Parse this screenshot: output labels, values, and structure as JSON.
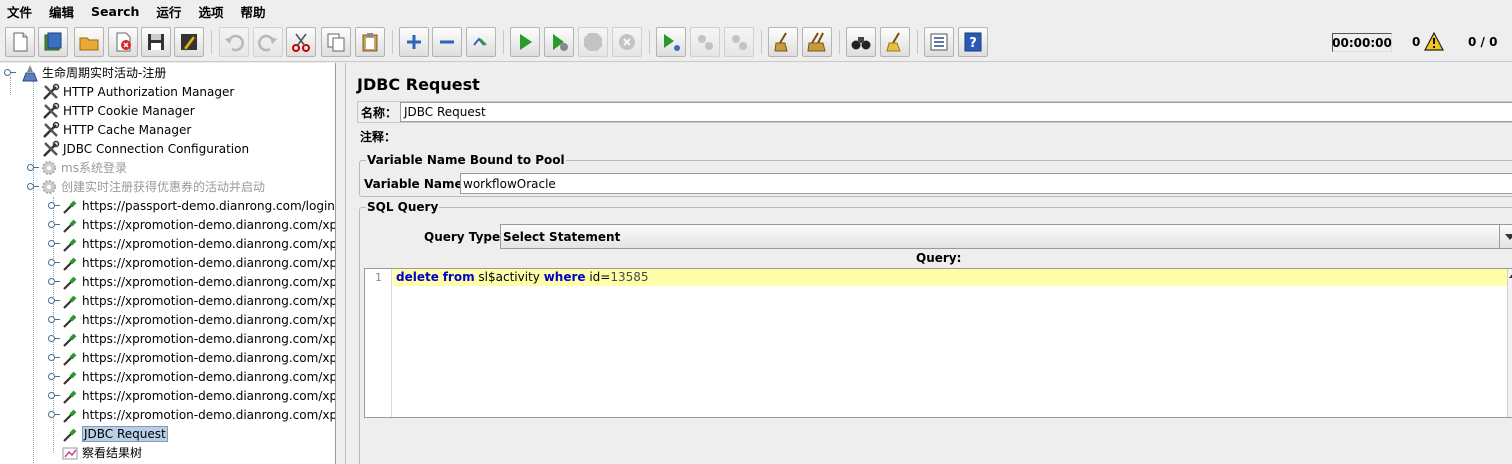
{
  "menu": [
    "文件",
    "编辑",
    "Search",
    "运行",
    "选项",
    "帮助"
  ],
  "toolbar": {
    "timer": "00:00:00",
    "warnings": "0",
    "threads": "0 / 0"
  },
  "tree": {
    "root": "生命周期实时活动-注册",
    "config": [
      "HTTP Authorization Manager",
      "HTTP Cookie Manager",
      "HTTP Cache Manager",
      "JDBC Connection Configuration"
    ],
    "controllers": [
      "ms系统登录",
      "创建实时注册获得优惠券的活动并启动"
    ],
    "samplers": [
      "https://passport-demo.dianrong.com/login?ser",
      "https://xpromotion-demo.dianrong.com/xpro",
      "https://xpromotion-demo.dianrong.com/xpro",
      "https://xpromotion-demo.dianrong.com/xpro",
      "https://xpromotion-demo.dianrong.com/xpro",
      "https://xpromotion-demo.dianrong.com/xpro",
      "https://xpromotion-demo.dianrong.com/xpro",
      "https://xpromotion-demo.dianrong.com/xpro",
      "https://xpromotion-demo.dianrong.com/xpro",
      "https://xpromotion-demo.dianrong.com/xpro",
      "https://xpromotion-demo.dianrong.com/xpro",
      "https://xpromotion-demo.dianrong.com/xpro"
    ],
    "selected": "JDBC Request",
    "listener": "察看结果树"
  },
  "panel": {
    "title": "JDBC Request",
    "name_label": "名称：",
    "name_value": "JDBC Request",
    "comment_label": "注释：",
    "comment_value": "",
    "pool_group": "Variable Name Bound to Pool",
    "variable_name_label": "Variable Name:",
    "variable_name_value": "workflowOracle",
    "sql_group": "SQL Query",
    "query_type_label": "Query Type:",
    "query_type_value": "Select Statement",
    "query_label": "Query:",
    "line_number": "1",
    "query": {
      "kw1": "delete",
      "kw2": "from",
      "table": "sl$activity",
      "kw3": "where",
      "col": "id=",
      "value": "13585"
    }
  },
  "colors": {
    "keyword": "#0000cc",
    "current_line": "#ffffaa",
    "selection": "#b8cfe5"
  }
}
